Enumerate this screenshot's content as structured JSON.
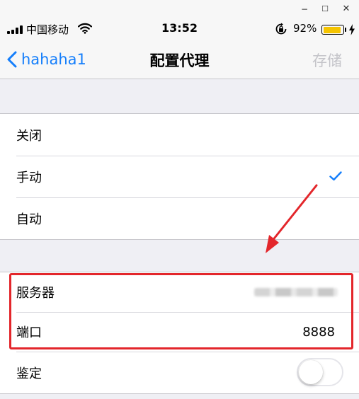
{
  "window": {
    "min_glyph": "−",
    "max_glyph": "☐",
    "close_glyph": "✕"
  },
  "status_bar": {
    "carrier": "中国移动",
    "time": "13:52",
    "battery_percent": "92%",
    "battery_level": 0.92,
    "battery_color": "#f5c400",
    "icons": [
      "signal-icon",
      "wifi-icon",
      "orientation-lock-icon",
      "battery-icon",
      "charging-bolt-icon"
    ]
  },
  "nav": {
    "back_label": "hahaha1",
    "title": "配置代理",
    "save_label": "存储",
    "accent_color": "#147efb"
  },
  "proxy_modes": {
    "items": [
      {
        "label": "关闭",
        "selected": false
      },
      {
        "label": "手动",
        "selected": true
      },
      {
        "label": "自动",
        "selected": false
      }
    ]
  },
  "manual_settings": {
    "server_label": "服务器",
    "server_value_redacted": true,
    "port_label": "端口",
    "port_value": "8888"
  },
  "auth": {
    "label": "鉴定",
    "enabled": false
  },
  "annotation": {
    "color": "#e3262b"
  }
}
